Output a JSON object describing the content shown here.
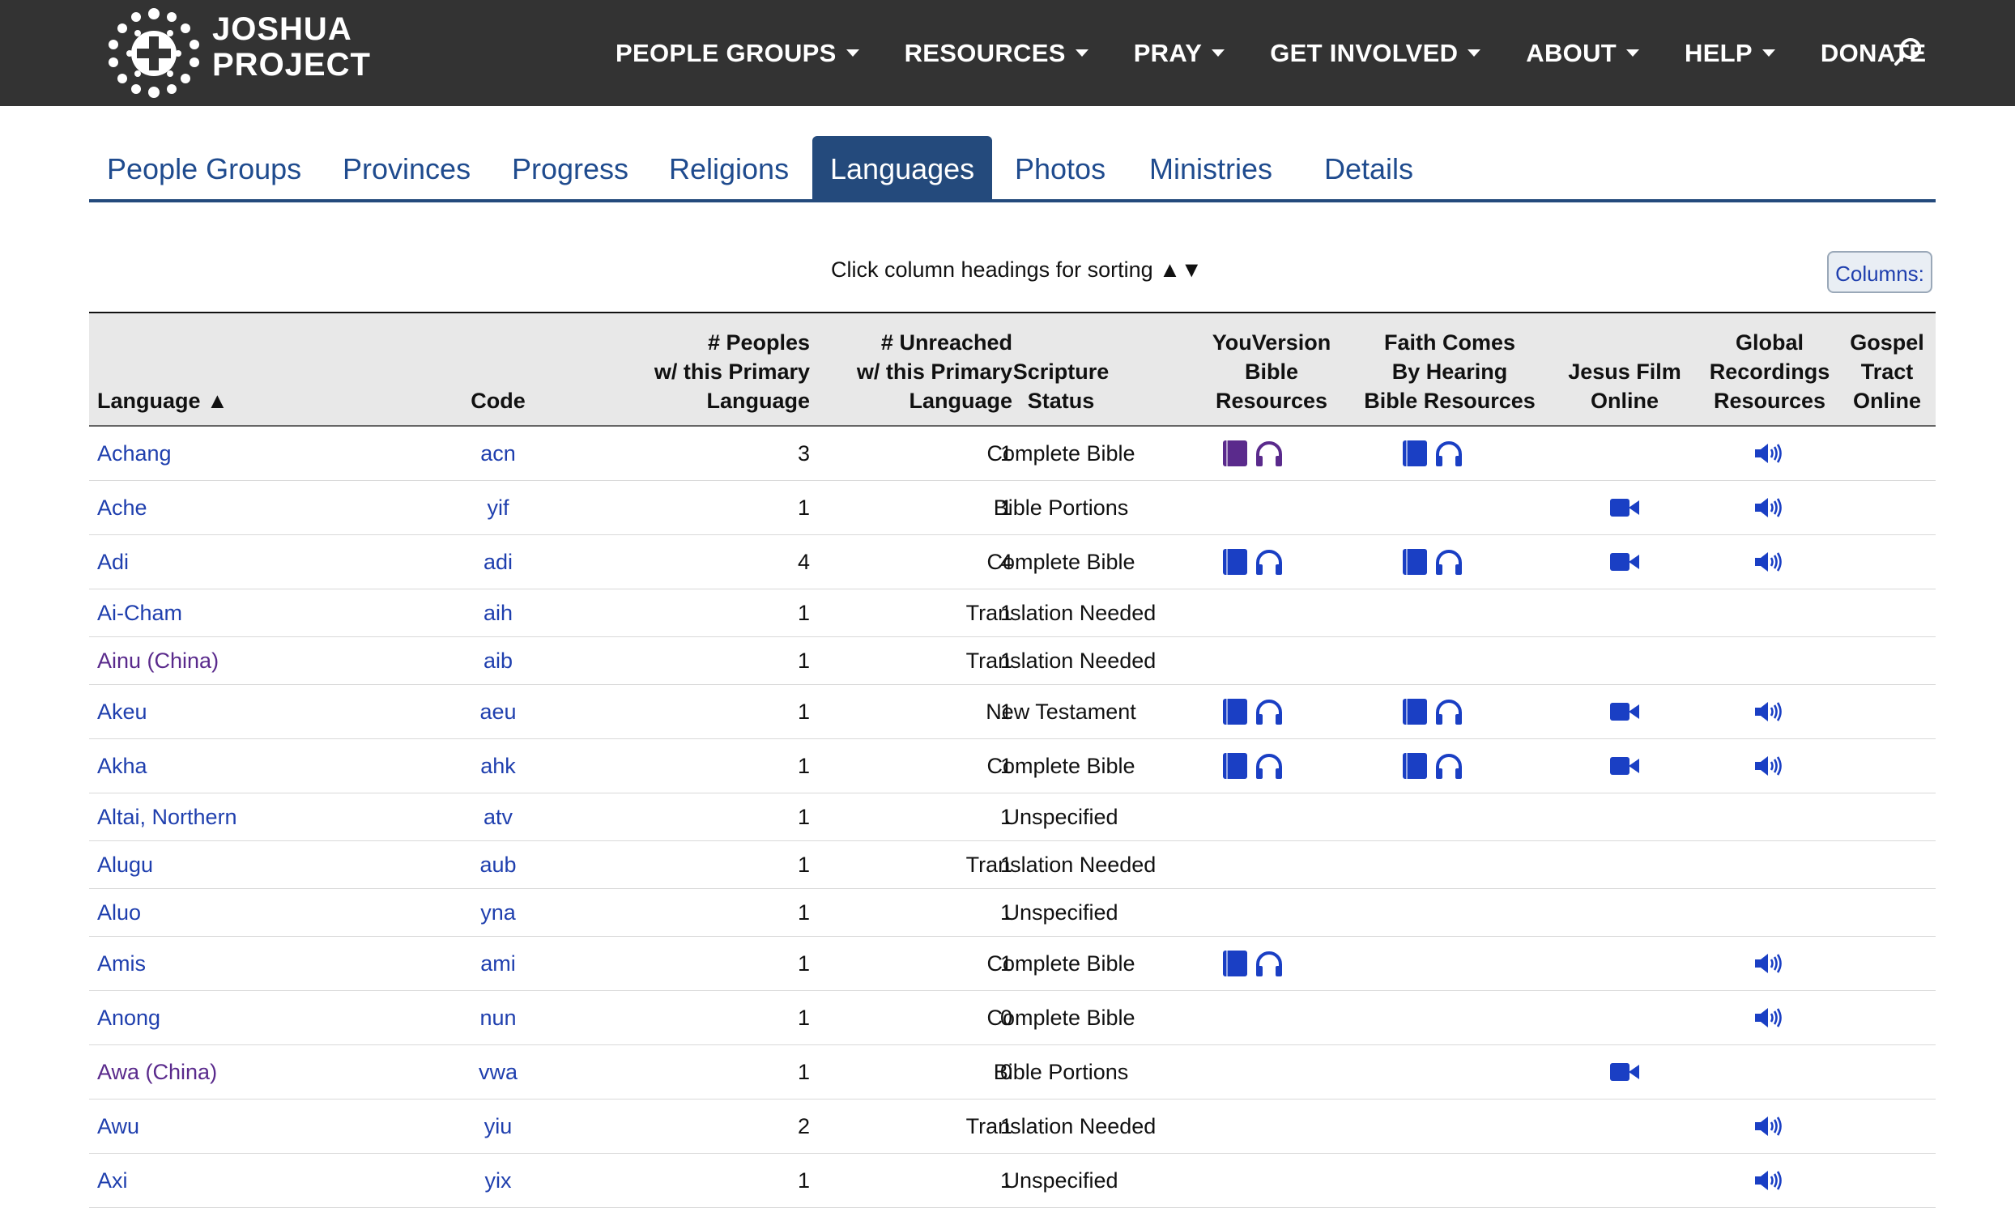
{
  "brand": {
    "line1": "JOSHUA",
    "line2": "PROJECT"
  },
  "nav": [
    {
      "label": "PEOPLE GROUPS",
      "dropdown": true
    },
    {
      "label": "RESOURCES",
      "dropdown": true
    },
    {
      "label": "PRAY",
      "dropdown": true
    },
    {
      "label": "GET INVOLVED",
      "dropdown": true
    },
    {
      "label": "ABOUT",
      "dropdown": true
    },
    {
      "label": "HELP",
      "dropdown": true
    },
    {
      "label": "DONATE",
      "dropdown": false
    }
  ],
  "tabs": [
    "People Groups",
    "Provinces",
    "Progress",
    "Religions",
    "Languages",
    "Photos",
    "Ministries",
    "Details"
  ],
  "active_tab": "Languages",
  "sort_hint": "Click column headings for sorting ▲▼",
  "columns_button": "Columns:",
  "headers": {
    "language": "Language ▲",
    "code": "Code",
    "peoples": [
      "# Peoples",
      "w/ this Primary",
      "Language"
    ],
    "unreached": [
      "# Unreached",
      "w/ this Primary",
      "Language"
    ],
    "scripture": [
      "Scripture",
      "Status"
    ],
    "youversion": [
      "YouVersion",
      "Bible",
      "Resources"
    ],
    "fch": [
      "Faith Comes",
      "By Hearing",
      "Bible Resources"
    ],
    "jesus_film": [
      "Jesus Film",
      "Online"
    ],
    "global_recordings": [
      "Global",
      "Recordings",
      "Resources"
    ],
    "gospel_tract": [
      "Gospel",
      "Tract",
      "Online"
    ]
  },
  "colors": {
    "topbar": "#333333",
    "tab_active": "#244a7c",
    "link": "#1f3fae",
    "link_visited": "#5a2a8c",
    "icon": "#1a3fc4",
    "icon_purple": "#5a2a8c"
  },
  "icons": {
    "bible": "bible-book-icon",
    "audio": "headphones-icon",
    "video": "video-camera-icon",
    "speaker": "speaker-icon",
    "search": "search-icon"
  },
  "rows": [
    {
      "language": "Achang",
      "code": "acn",
      "peoples": "3",
      "unreached": "1",
      "scripture": "Complete Bible",
      "yv": true,
      "yv_purple": true,
      "fch": true,
      "jf": false,
      "gr": true,
      "visited": false
    },
    {
      "language": "Ache",
      "code": "yif",
      "peoples": "1",
      "unreached": "1",
      "scripture": "Bible Portions",
      "yv": false,
      "fch": false,
      "jf": true,
      "gr": true,
      "visited": false
    },
    {
      "language": "Adi",
      "code": "adi",
      "peoples": "4",
      "unreached": "4",
      "scripture": "Complete Bible",
      "yv": true,
      "fch": true,
      "jf": true,
      "gr": true,
      "visited": false
    },
    {
      "language": "Ai-Cham",
      "code": "aih",
      "peoples": "1",
      "unreached": "1",
      "scripture": "Translation Needed",
      "yv": false,
      "fch": false,
      "jf": false,
      "gr": false,
      "visited": false
    },
    {
      "language": "Ainu (China)",
      "code": "aib",
      "peoples": "1",
      "unreached": "1",
      "scripture": "Translation Needed",
      "yv": false,
      "fch": false,
      "jf": false,
      "gr": false,
      "visited": true
    },
    {
      "language": "Akeu",
      "code": "aeu",
      "peoples": "1",
      "unreached": "1",
      "scripture": "New Testament",
      "yv": true,
      "fch": true,
      "jf": true,
      "gr": true,
      "visited": false
    },
    {
      "language": "Akha",
      "code": "ahk",
      "peoples": "1",
      "unreached": "1",
      "scripture": "Complete Bible",
      "yv": true,
      "fch": true,
      "jf": true,
      "gr": true,
      "visited": false
    },
    {
      "language": "Altai, Northern",
      "code": "atv",
      "peoples": "1",
      "unreached": "1",
      "scripture": "Unspecified",
      "yv": false,
      "fch": false,
      "jf": false,
      "gr": false,
      "visited": false
    },
    {
      "language": "Alugu",
      "code": "aub",
      "peoples": "1",
      "unreached": "1",
      "scripture": "Translation Needed",
      "yv": false,
      "fch": false,
      "jf": false,
      "gr": false,
      "visited": false
    },
    {
      "language": "Aluo",
      "code": "yna",
      "peoples": "1",
      "unreached": "1",
      "scripture": "Unspecified",
      "yv": false,
      "fch": false,
      "jf": false,
      "gr": false,
      "visited": false
    },
    {
      "language": "Amis",
      "code": "ami",
      "peoples": "1",
      "unreached": "1",
      "scripture": "Complete Bible",
      "yv": true,
      "fch": false,
      "jf": false,
      "gr": true,
      "visited": false
    },
    {
      "language": "Anong",
      "code": "nun",
      "peoples": "1",
      "unreached": "0",
      "scripture": "Complete Bible",
      "yv": false,
      "fch": false,
      "jf": false,
      "gr": true,
      "visited": false
    },
    {
      "language": "Awa (China)",
      "code": "vwa",
      "peoples": "1",
      "unreached": "0",
      "scripture": "Bible Portions",
      "yv": false,
      "fch": false,
      "jf": true,
      "gr": false,
      "visited": true
    },
    {
      "language": "Awu",
      "code": "yiu",
      "peoples": "2",
      "unreached": "1",
      "scripture": "Translation Needed",
      "yv": false,
      "fch": false,
      "jf": false,
      "gr": true,
      "visited": false
    },
    {
      "language": "Axi",
      "code": "yix",
      "peoples": "1",
      "unreached": "1",
      "scripture": "Unspecified",
      "yv": false,
      "fch": false,
      "jf": false,
      "gr": true,
      "visited": false
    }
  ]
}
